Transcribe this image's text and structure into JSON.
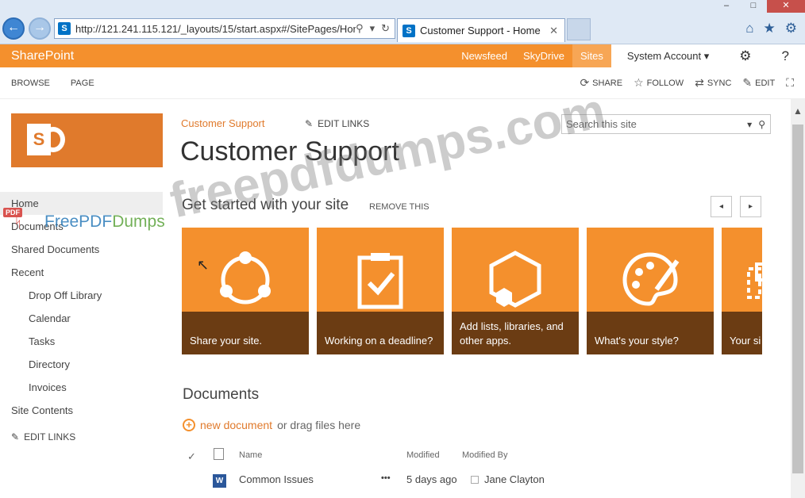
{
  "browser": {
    "address_url": "http://121.241.115.121/_layouts/15/start.aspx#/SitePages/Hor",
    "favicon_letter": "S",
    "tab_title": "Customer Support - Home",
    "tab_close": "✕",
    "back_glyph": "←",
    "forward_glyph": "→",
    "search_glyph": "⚲",
    "dropdown_glyph": "▾",
    "refresh_glyph": "↻",
    "home_glyph": "⌂",
    "star_glyph": "★",
    "gear_glyph": "⚙",
    "minimize": "–",
    "maximize": "□",
    "close": "✕"
  },
  "suitebar": {
    "brand": "SharePoint",
    "links": [
      "Newsfeed",
      "SkyDrive",
      "Sites"
    ],
    "active_link": "Sites",
    "account": "System Account ▾",
    "settings_glyph": "⚙",
    "help_glyph": "?",
    "color": "#f4902d"
  },
  "ribbon": {
    "tabs": [
      "BROWSE",
      "PAGE"
    ],
    "actions": [
      {
        "glyph": "⟳",
        "label": "SHARE"
      },
      {
        "glyph": "☆",
        "label": "FOLLOW"
      },
      {
        "glyph": "⇄",
        "label": "SYNC"
      },
      {
        "glyph": "✎",
        "label": "EDIT"
      }
    ],
    "focus_glyph": "⛶"
  },
  "site": {
    "logo_letter": "S",
    "breadcrumb": "Customer Support",
    "edit_links_glyph": "✎",
    "edit_links": "EDIT LINKS",
    "title": "Customer Support",
    "search_placeholder": "Search this site",
    "search_dropdown": "▾",
    "search_glyph": "⚲"
  },
  "quicklaunch": {
    "items": [
      {
        "label": "Home",
        "level": 0,
        "selected": true
      },
      {
        "label": "Documents",
        "level": 0
      },
      {
        "label": "Shared Documents",
        "level": 0
      },
      {
        "label": "Recent",
        "level": 0
      },
      {
        "label": "Drop Off Library",
        "level": 1
      },
      {
        "label": "Calendar",
        "level": 1
      },
      {
        "label": "Tasks",
        "level": 1
      },
      {
        "label": "Directory",
        "level": 1
      },
      {
        "label": "Invoices",
        "level": 1
      },
      {
        "label": "Site Contents",
        "level": 0
      }
    ],
    "edit_links_glyph": "✎",
    "edit_links": "EDIT LINKS"
  },
  "get_started": {
    "heading": "Get started with your site",
    "remove": "REMOVE THIS",
    "prev_glyph": "◂",
    "next_glyph": "▸",
    "tiles": [
      {
        "caption": "Share your site.",
        "icon": "share-icon"
      },
      {
        "caption": "Working on a deadline?",
        "icon": "clipboard-check-icon"
      },
      {
        "caption": "Add lists, libraries, and other apps.",
        "icon": "hexagon-apps-icon"
      },
      {
        "caption": "What's your style?",
        "icon": "palette-icon"
      },
      {
        "caption": "Your si",
        "icon": "layout-icon"
      }
    ],
    "tile_color": "#f4902d",
    "caption_color": "#6b3c13"
  },
  "documents": {
    "heading": "Documents",
    "new_link": "new document",
    "new_rest": "or drag files here",
    "plus_glyph": "+",
    "columns": {
      "check": "✓",
      "name": "Name",
      "modified": "Modified",
      "modified_by": "Modified By"
    },
    "rows": [
      {
        "name": "Common Issues",
        "ellipsis": "•••",
        "modified": "5 days ago",
        "modified_by": "Jane Clayton",
        "icon": "word-doc-icon"
      }
    ]
  },
  "watermark": {
    "pdf_tag": "PDF",
    "logo_blue": "FreePDF",
    "logo_green": "Dumps",
    "big_text": "freepdfdumps.com"
  },
  "scrollbar": {
    "up_glyph": "▲"
  },
  "cursor_glyph": "↖"
}
